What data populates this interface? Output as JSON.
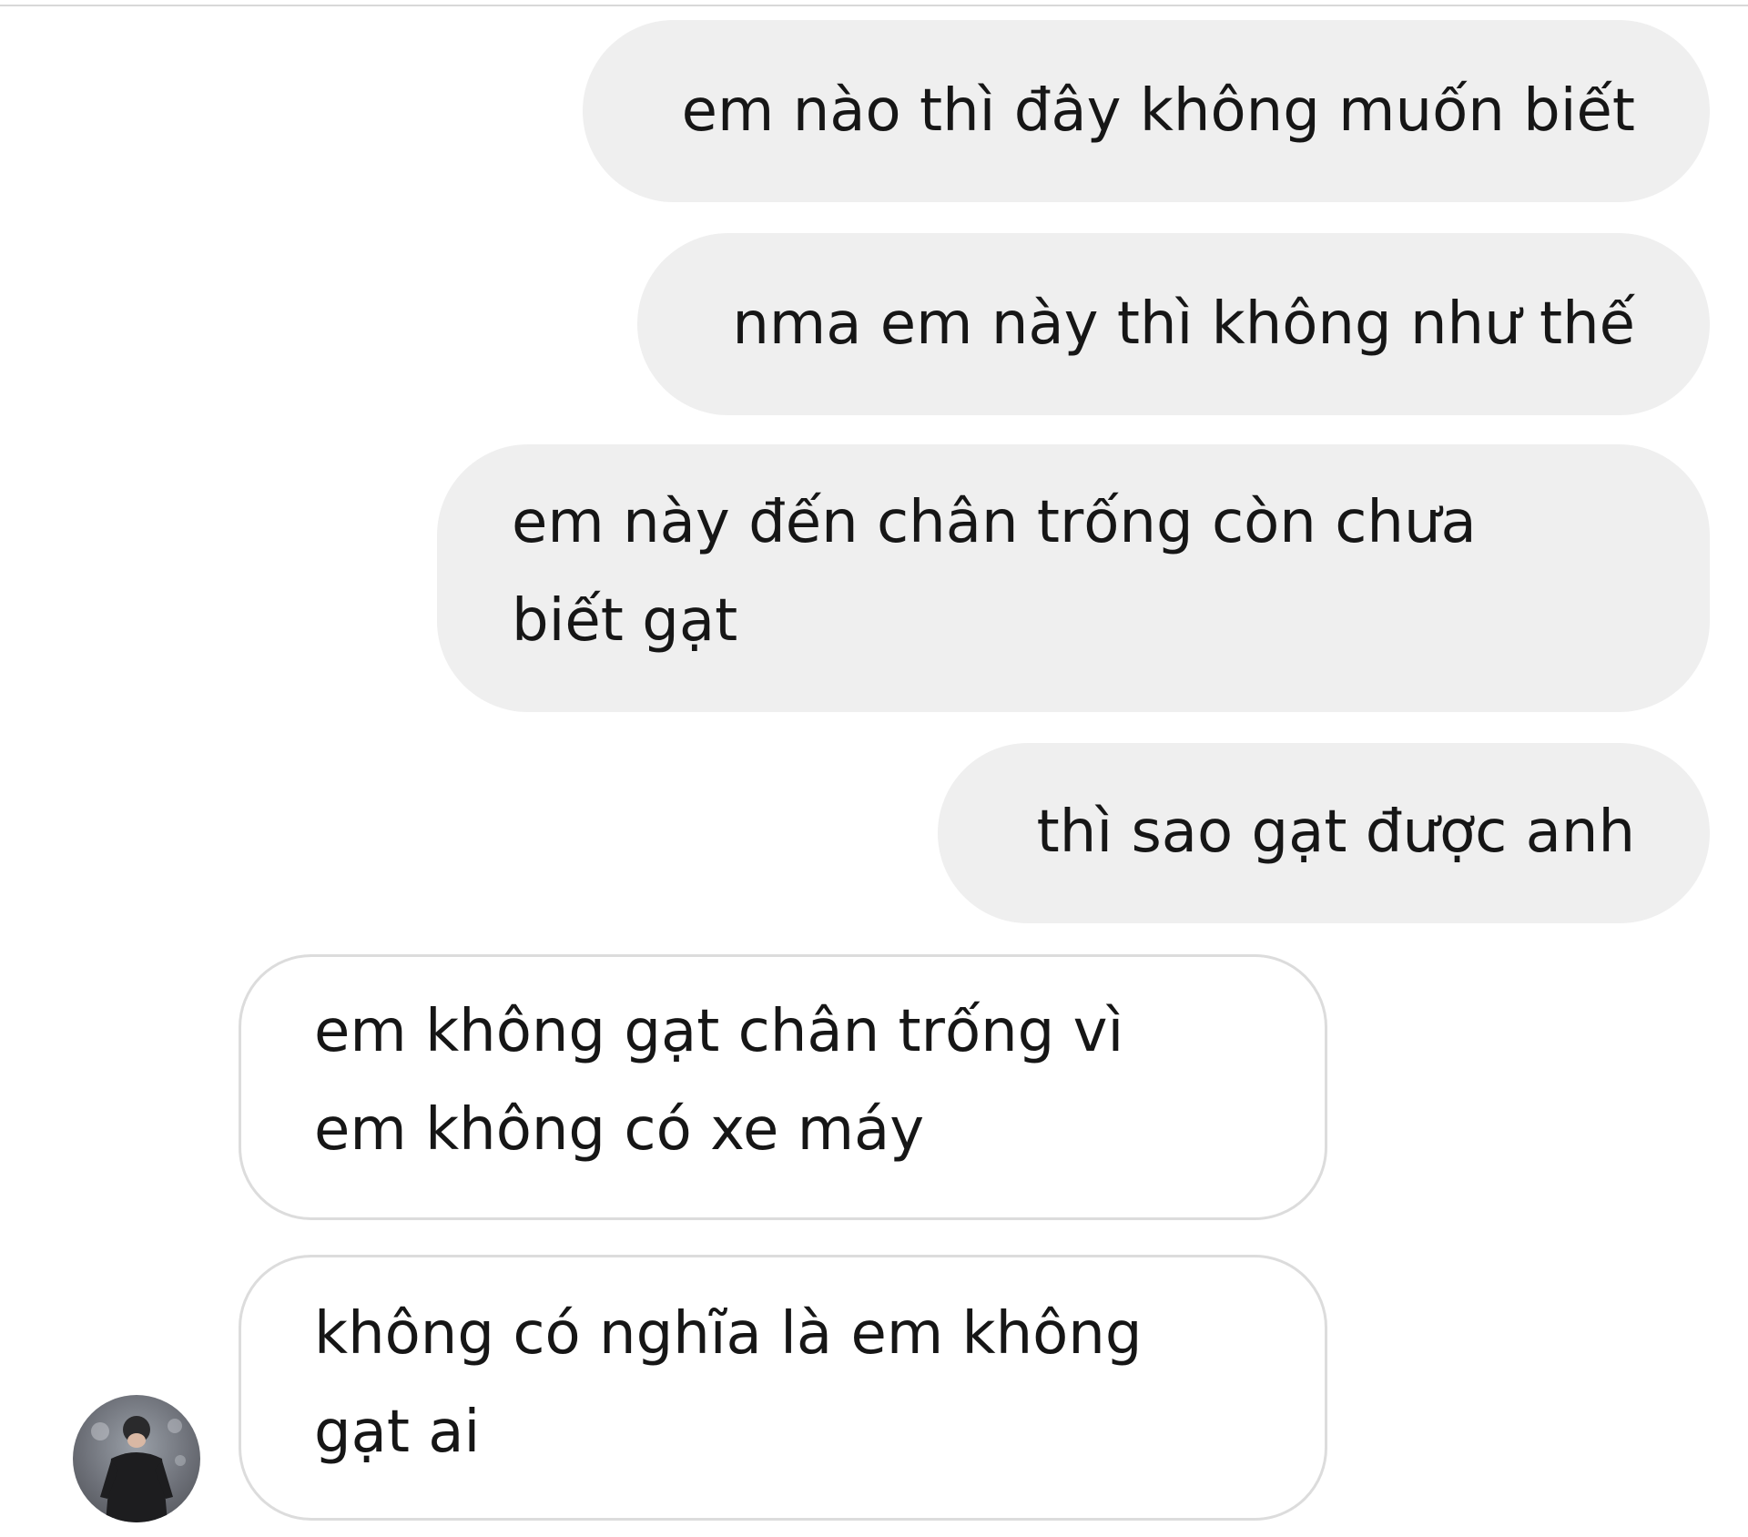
{
  "conversation": {
    "messages": [
      {
        "side": "sent",
        "lines": [
          "em nào thì đây không muốn biết"
        ]
      },
      {
        "side": "sent",
        "lines": [
          "nma em này thì không như thế"
        ]
      },
      {
        "side": "sent",
        "lines": [
          "em này đến chân trống còn chưa",
          "biết gạt"
        ]
      },
      {
        "side": "sent",
        "lines": [
          "thì sao gạt được anh"
        ]
      },
      {
        "side": "received",
        "lines": [
          "em không gạt chân trống vì",
          "em không có xe máy"
        ]
      },
      {
        "side": "received",
        "lines": [
          "không có nghĩa là em không",
          "gạt ai"
        ]
      }
    ]
  },
  "contact": {
    "avatar_icon": "contact-avatar"
  },
  "colors": {
    "sent_bubble": "#efefef",
    "received_bubble_border": "#dcdcdc",
    "text": "#161616",
    "background": "#ffffff"
  }
}
